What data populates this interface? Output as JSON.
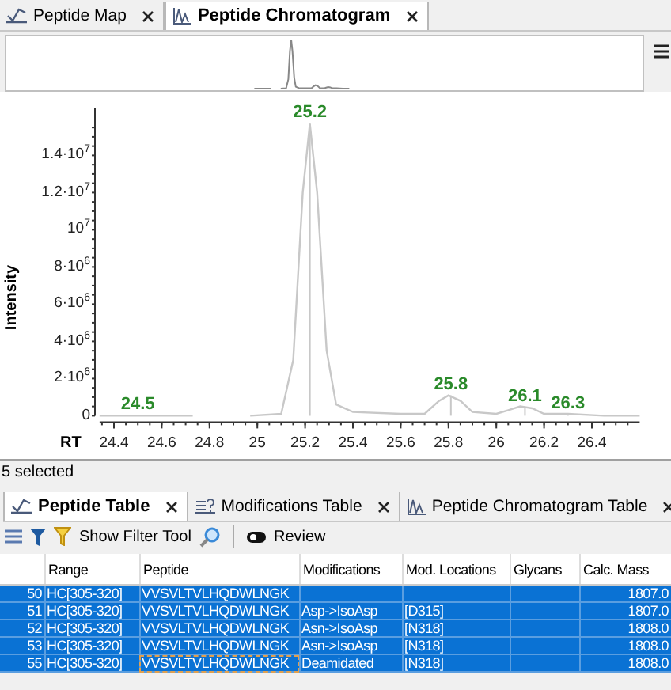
{
  "top_tabs": [
    {
      "label": "Peptide Map",
      "selected": false
    },
    {
      "label": "Peptide Chromatogram",
      "selected": true
    }
  ],
  "chromatogram": {
    "chart_data": {
      "type": "line",
      "xlabel": "RT",
      "ylabel": "Intensity",
      "x": [
        24.34,
        24.5,
        24.73,
        24.85,
        24.97,
        25.1,
        25.15,
        25.19,
        25.22,
        25.25,
        25.29,
        25.33,
        25.4,
        25.6,
        25.7,
        25.76,
        25.8,
        25.85,
        25.9,
        26.0,
        26.05,
        26.1,
        26.15,
        26.2,
        26.3,
        26.45,
        26.6
      ],
      "series": [
        {
          "color": "#c8c8c8",
          "values": [
            0,
            0,
            0,
            null,
            0,
            100000,
            3000000,
            12000000,
            15700000,
            12000000,
            3500000,
            600000,
            200000,
            100000,
            100000,
            800000,
            1100000,
            800000,
            200000,
            100000,
            300000,
            500000,
            400000,
            100000,
            100000,
            0,
            0
          ]
        }
      ],
      "xlim": [
        24.34,
        26.6
      ],
      "ylim": [
        0,
        15700000
      ],
      "xticks": [
        24.4,
        24.6,
        24.8,
        25,
        25.2,
        25.4,
        25.6,
        25.8,
        26,
        26.2,
        26.4
      ],
      "yticks": [
        {
          "value": 0,
          "label": "0"
        },
        {
          "value": 2000000,
          "label": "2·10$^{6}$"
        },
        {
          "value": 4000000,
          "label": "4·10$^{6}$"
        },
        {
          "value": 6000000,
          "label": "6·10$^{6}$"
        },
        {
          "value": 8000000,
          "label": "8·10$^{6}$"
        },
        {
          "value": 10000000,
          "label": "10$^{7}$"
        },
        {
          "value": 12000000,
          "label": "1.2·10$^{7}$"
        },
        {
          "value": 14000000,
          "label": "1.4·10$^{7}$"
        }
      ],
      "ref_lines": [
        {
          "axis": "x",
          "value": 25.22
        }
      ],
      "annotations": [
        {
          "x": 24.5,
          "y": 0,
          "text": "24.5"
        },
        {
          "x": 25.22,
          "y": 15700000,
          "text": "25.2"
        },
        {
          "x": 25.81,
          "y": 1100000,
          "text": "25.8"
        },
        {
          "x": 26.12,
          "y": 450000,
          "text": "26.1"
        },
        {
          "x": 26.3,
          "y": 50000,
          "text": "26.3"
        }
      ]
    }
  },
  "status": "5 selected",
  "bottom_tabs": [
    {
      "label": "Peptide Table",
      "selected": true
    },
    {
      "label": "Modifications Table",
      "selected": false
    },
    {
      "label": "Peptide Chromatogram Table",
      "selected": false
    }
  ],
  "toolbar": {
    "filter_label": "Show Filter Tool",
    "review_label": "Review"
  },
  "table": {
    "columns": [
      "",
      "Range",
      "Peptide",
      "Modifications",
      "Mod. Locations",
      "Glycans",
      "Calc. Mass"
    ],
    "rows": [
      {
        "selected": true,
        "cells": [
          "50",
          "HC[305-320]",
          "VVSVLTVLHQDWLNGK",
          "",
          "",
          "",
          "1807.0"
        ]
      },
      {
        "selected": true,
        "cells": [
          "51",
          "HC[305-320]",
          "VVSVLTVLHQDWLNGK",
          "Asp->IsoAsp",
          "[D315]",
          "",
          "1807.0"
        ]
      },
      {
        "selected": true,
        "cells": [
          "52",
          "HC[305-320]",
          "VVSVLTVLHQDWLNGK",
          "Asn->IsoAsp",
          "[N318]",
          "",
          "1808.0"
        ]
      },
      {
        "selected": true,
        "cells": [
          "53",
          "HC[305-320]",
          "VVSVLTVLHQDWLNGK",
          "Asn->IsoAsp",
          "[N318]",
          "",
          "1808.0"
        ]
      },
      {
        "selected": true,
        "cells": [
          "55",
          "HC[305-320]",
          "VVSVLTVLHQDWLNGK",
          "Deamidated",
          "[N318]",
          "",
          "1808.0"
        ]
      }
    ]
  }
}
